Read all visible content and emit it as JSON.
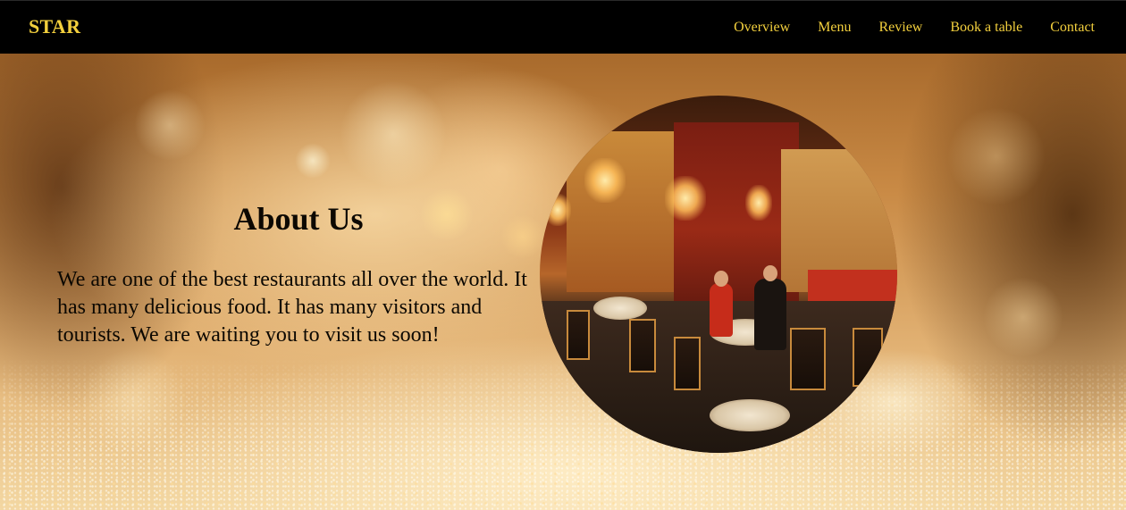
{
  "nav": {
    "brand": "STAR",
    "links": [
      "Overview",
      "Menu",
      "Review",
      "Book a table",
      "Contact"
    ]
  },
  "about": {
    "title": "About Us",
    "text": "We are one of the best restaurants all over the world. It has many delicious food. It has many visitors and tourists. We are waiting you to visit us soon!"
  },
  "colors": {
    "nav_background": "#000000",
    "nav_text": "#f2cf3d",
    "body_text": "#0c0802"
  }
}
